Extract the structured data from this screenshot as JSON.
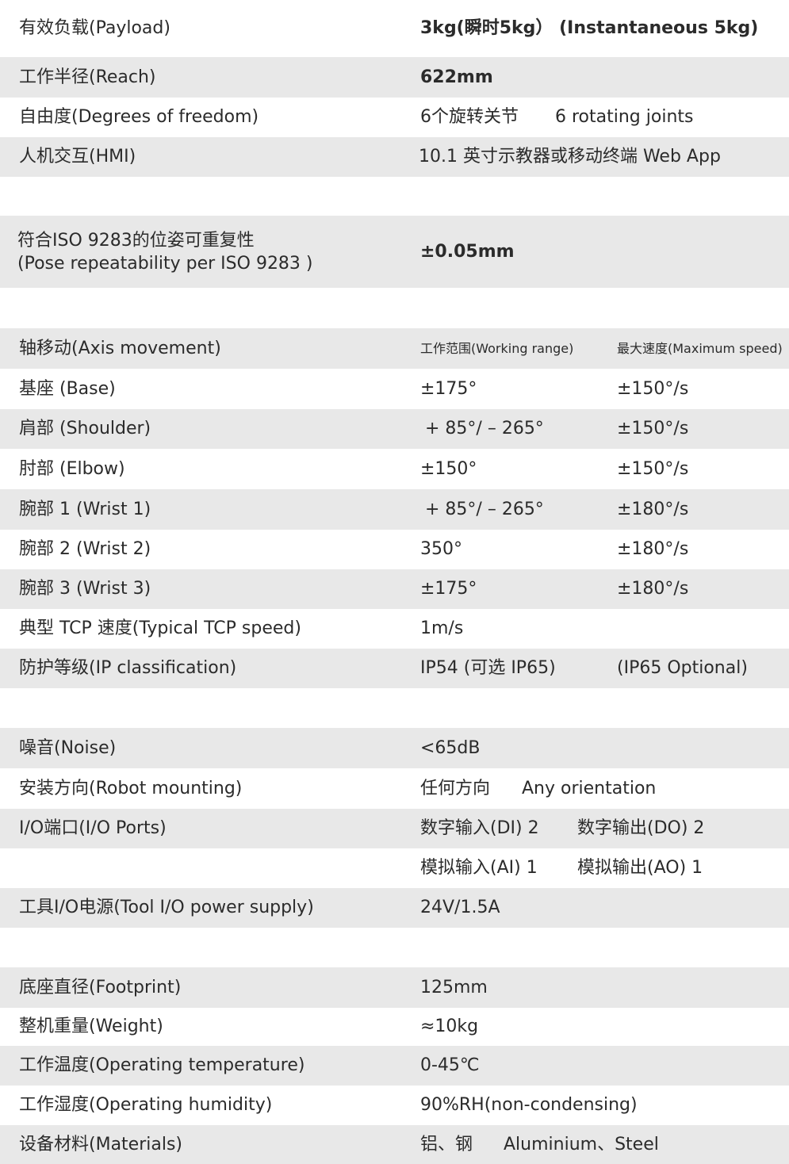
{
  "spec_rows": [
    {
      "label": "有效负载(Payload)",
      "v1": "3kg(瞬时5kg） (Instantaneous 5kg)"
    },
    {
      "label": "工作半径(Reach)",
      "v1": "622mm"
    },
    {
      "label": "自由度(Degrees of freedom)",
      "v1": "6个旋转关节",
      "v2": "6 rotating joints"
    },
    {
      "label": "人机交互(HMI)",
      "v1": "10.1 英寸示教器或移动终端 Web App"
    },
    {
      "label_line1": "符合ISO 9283的位姿可重复性",
      "label_line2": "(Pose repeatability per ISO 9283 )",
      "v1": "±0.05mm"
    },
    {
      "label": "轴移动(Axis movement)",
      "v1": "工作范围(Working range)",
      "v2": "最大速度(Maximum speed)"
    },
    {
      "label": "基座 (Base)",
      "v1": "±175°",
      "v2": "±150°/s"
    },
    {
      "label": "肩部 (Shoulder)",
      "v1": "+ 85°/ – 265°",
      "v2": "±150°/s"
    },
    {
      "label": "肘部 (Elbow)",
      "v1": "±150°",
      "v2": "±150°/s"
    },
    {
      "label": "腕部 1 (Wrist 1)",
      "v1": "+ 85°/ – 265°",
      "v2": "±180°/s"
    },
    {
      "label": "腕部 2 (Wrist 2)",
      "v1": "350°",
      "v2": "±180°/s"
    },
    {
      "label": "腕部 3 (Wrist 3)",
      "v1": "±175°",
      "v2": "±180°/s"
    },
    {
      "label": "典型 TCP 速度(Typical TCP speed)",
      "v1": "1m/s"
    },
    {
      "label": "防护等级(IP classification)",
      "v1": "IP54 (可选 IP65)",
      "v2": "(IP65 Optional)"
    },
    {
      "label": "噪音(Noise)",
      "v1": "<65dB"
    },
    {
      "label": "安装方向(Robot mounting)",
      "v1": "任何方向",
      "v2": "Any orientation"
    },
    {
      "label": "I/O端口(I/O Ports)",
      "v1": "数字输入(DI) 2",
      "v2": "数字输出(DO) 2"
    },
    {
      "label": "",
      "v1": "模拟输入(AI) 1",
      "v2": "模拟输出(AO) 1"
    },
    {
      "label": "工具I/O电源(Tool I/O power supply)",
      "v1": "24V/1.5A"
    },
    {
      "label": "底座直径(Footprint)",
      "v1": "125mm"
    },
    {
      "label": "整机重量(Weight)",
      "v1": "≈10kg"
    },
    {
      "label": "工作温度(Operating temperature)",
      "v1": "0-45℃"
    },
    {
      "label": "工作湿度(Operating humidity)",
      "v1": "90%RH(non-condensing)"
    },
    {
      "label": "设备材料(Materials)",
      "v1": "铝、钢",
      "v2": "Aluminium、Steel"
    }
  ],
  "colors": {
    "row_shade": "#e8e8e8",
    "row_plain": "#ffffff",
    "text": "#2b2b2b"
  }
}
